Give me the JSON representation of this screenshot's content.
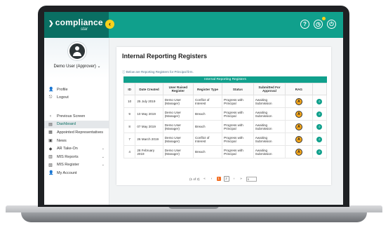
{
  "app": {
    "logo": "compliance",
    "logo_sub": "star",
    "collapse_icon": "‹"
  },
  "topbar": {
    "icons": [
      "help-icon",
      "notification-icon",
      "power-icon"
    ]
  },
  "user": {
    "name": "Demo User (Approver)",
    "chevron": "⌄"
  },
  "menu_top": [
    {
      "label": "Profile",
      "icon": "👤"
    },
    {
      "label": "Logout",
      "icon": "⎋"
    }
  ],
  "menu_main": [
    {
      "label": "Previous Screen",
      "icon": "‹"
    },
    {
      "label": "Dashboard",
      "icon": "▤"
    },
    {
      "label": "Appointed Representatives",
      "icon": "▦"
    },
    {
      "label": "News",
      "icon": "▣"
    },
    {
      "label": "AR Take-On",
      "icon": "◆",
      "arrow": "⌄"
    },
    {
      "label": "MIS Reports",
      "icon": "▥",
      "arrow": "⌄"
    },
    {
      "label": "MIS Register",
      "icon": "▧",
      "arrow": "⌄"
    },
    {
      "label": "My Account",
      "icon": "👤"
    }
  ],
  "page": {
    "title": "Internal Reporting Registers",
    "description": "Below are Reporting Registers for Principal firm.",
    "table_caption": "Internal Reporting Registers"
  },
  "table": {
    "headers": [
      "ID",
      "Date Created",
      "User Raised Register",
      "Register Type",
      "Status",
      "Submitted For Approval",
      "RAG",
      ""
    ],
    "rows": [
      {
        "id": "10",
        "date": "25 July 2019",
        "user": "Demo User (Manager)",
        "type": "Conflict of Interest",
        "status": "Progress with Principal",
        "submitted": "Awaiting Submission",
        "rag": "A"
      },
      {
        "id": "9",
        "date": "10 May 2019",
        "user": "Demo User (Manager)",
        "type": "Breach",
        "status": "Progress with Principal",
        "submitted": "Awaiting Submission",
        "rag": "A"
      },
      {
        "id": "8",
        "date": "07 May 2019",
        "user": "Demo User (Manager)",
        "type": "Breach",
        "status": "Progress with Principal",
        "submitted": "Awaiting Submission",
        "rag": "A"
      },
      {
        "id": "7",
        "date": "26 March 2019",
        "user": "Demo User (Manager)",
        "type": "Conflict of Interest",
        "status": "Progress with Principal",
        "submitted": "Awaiting Submission",
        "rag": "A"
      },
      {
        "id": "4",
        "date": "28 February 2019",
        "user": "Demo User (Manager)",
        "type": "Breach",
        "status": "Progress with Principal",
        "submitted": "Awaiting Submission",
        "rag": "A"
      }
    ],
    "view_icon": "⌕"
  },
  "pagination": {
    "summary": "(1 of 2)",
    "first": "«",
    "prev": "‹",
    "pages": [
      "1",
      "2"
    ],
    "next": "›",
    "last": "»",
    "page_size": "5"
  },
  "colors": {
    "primary": "#10a08c",
    "dark_primary": "#0a6f63",
    "accent": "#f7d21b",
    "amber": "#f7a81b",
    "pager_current": "#f26d21"
  }
}
